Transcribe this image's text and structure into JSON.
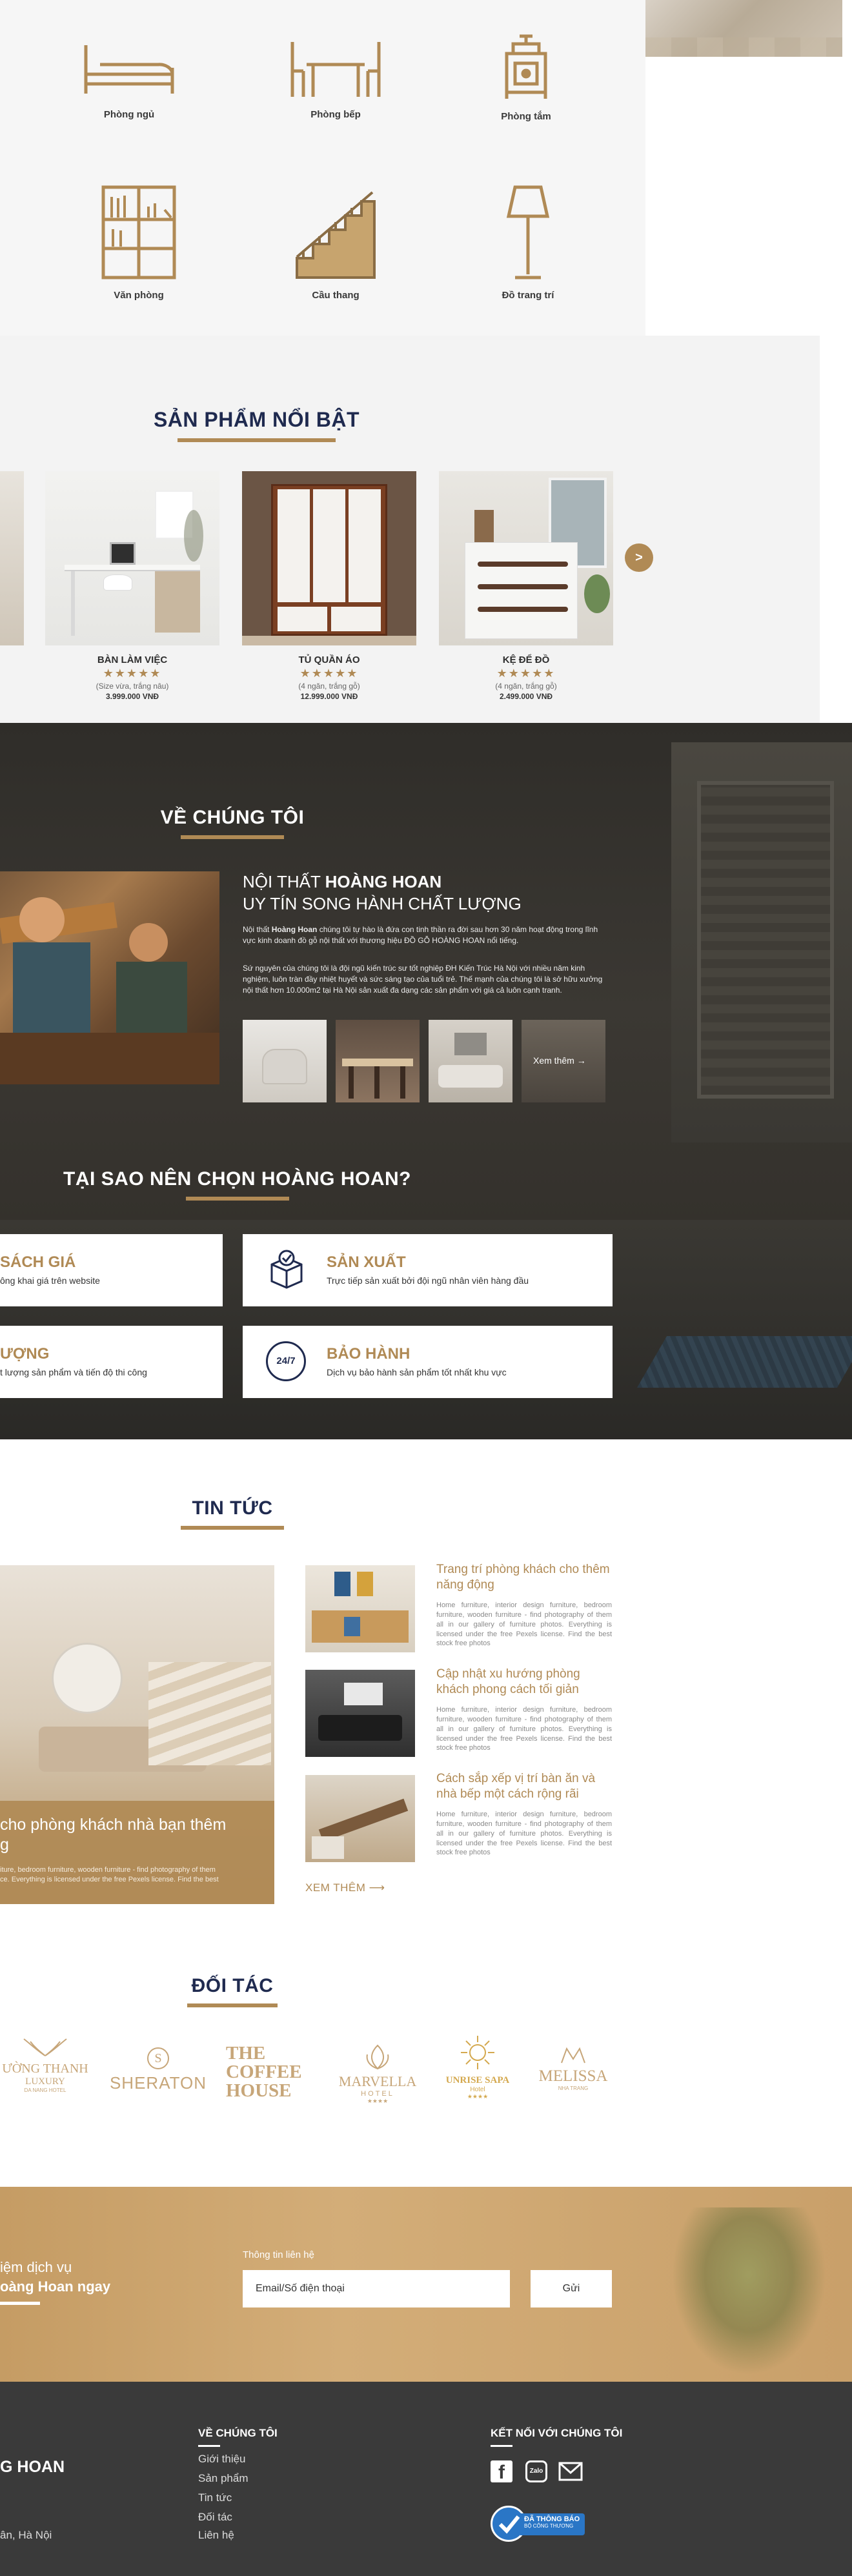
{
  "categories": {
    "items": [
      {
        "label": "Phòng ngủ",
        "icon": "bed-icon"
      },
      {
        "label": "Phòng bếp",
        "icon": "dining-table-icon"
      },
      {
        "label": "Phòng tắm",
        "icon": "coffee-grinder-icon"
      },
      {
        "label": "Văn phòng",
        "icon": "bookshelf-icon"
      },
      {
        "label": "Cầu thang",
        "icon": "staircase-icon"
      },
      {
        "label": "Đồ trang trí",
        "icon": "floor-lamp-icon"
      }
    ]
  },
  "featured": {
    "title": "SẢN PHẨM NỔI BẬT",
    "stars": "★★★★★",
    "next_label": ">",
    "products": [
      {
        "name": "BÀN LÀM VIỆC",
        "spec": "(Size vừa, trắng nâu)",
        "price": "3.999.000 VNĐ"
      },
      {
        "name": "TỦ QUẦN ÁO",
        "spec": "(4 ngăn, trắng gỗ)",
        "price": "12.999.000 VNĐ"
      },
      {
        "name": "KỆ ĐỂ ĐỒ",
        "spec": "(4 ngăn, trắng gỗ)",
        "price": "2.499.000 VNĐ"
      }
    ]
  },
  "about": {
    "title": "VỀ CHÚNG TÔI",
    "heading_prefix": "NỘI THẤT ",
    "heading_brand": "HOÀNG HOAN",
    "subheading": "UY TÍN SONG HÀNH CHẤT LƯỢNG",
    "para1_prefix": "Nội thất ",
    "para1_brand": "Hoàng Hoan",
    "para1_rest": " chúng tôi tự hào là đứa con tinh thần ra đời sau hơn 30 năm hoạt động trong lĩnh vực kinh doanh đồ gỗ nội thất với thương hiệu ĐỒ GỖ HOÀNG HOAN nổi tiếng.",
    "para2": "Sứ nguyên của chúng tôi là đội ngũ kiến trúc sư tốt nghiệp ĐH Kiến Trúc Hà Nội với nhiều năm kinh nghiệm, luôn tràn đầy nhiệt huyết và sức sáng tạo của tuổi trẻ. Thế mạnh của chúng tôi là sở hữu xưởng nội thất hơn 10.000m2 tại Hà Nội sản xuất đa dạng các sản phẩm với giá cả luôn cạnh tranh.",
    "more_label": "Xem thêm →"
  },
  "why": {
    "title": "TẠI SAO NÊN CHỌN HOÀNG HOAN?",
    "cards": [
      {
        "title": "SÁCH GIÁ",
        "desc": "ông khai giá trên website",
        "icon": ""
      },
      {
        "title": "SẢN XUẤT",
        "desc": "Trực tiếp sản xuất bởi đội ngũ nhân viên hàng đầu",
        "icon": "verified-box-icon"
      },
      {
        "title": "ƯỢNG",
        "desc": "t lượng sản phẩm và tiến độ thi công",
        "icon": ""
      },
      {
        "title": "BẢO HÀNH",
        "desc": "Dịch vụ bảo hành sản phẩm tốt nhất khu vực",
        "icon": "support-24-7-icon",
        "badge": "24/7"
      }
    ]
  },
  "news": {
    "title": "TIN TỨC",
    "feature_caption": " cho phòng khách nhà bạn thêm\ng",
    "feature_desc": "iture, bedroom furniture, wooden furniture - find photography of them\nce. Everything is licensed under the free Pexels license. Find the best",
    "items": [
      {
        "title": "Trang trí phòng khách cho thêm năng động",
        "desc": "Home furniture, interior design furniture, bedroom furniture, wooden furniture - find photography of them all in our gallery of furniture photos. Everything is licensed under the free Pexels license. Find the best stock free photos"
      },
      {
        "title": "Cập nhật xu hướng phòng khách phong cách tối giản",
        "desc": "Home furniture, interior design furniture, bedroom furniture, wooden furniture - find photography of them all in our gallery of furniture photos. Everything is licensed under the free Pexels license. Find the best stock free photos"
      },
      {
        "title": "Cách sắp xếp vị trí bàn ăn và nhà bếp một cách rộng rãi",
        "desc": "Home furniture, interior design furniture, bedroom furniture, wooden furniture - find photography of them all in our gallery of furniture photos. Everything is licensed under the free Pexels license. Find the best stock free photos"
      }
    ],
    "more_label": "XEM THÊM ⟶"
  },
  "partners": {
    "title": "ĐỐI TÁC",
    "logos": [
      {
        "main": "ƯỜNG THANH",
        "sub": "LUXURY",
        "tag": "DA NANG HOTEL"
      },
      {
        "main": "SHERATON",
        "sub": "S",
        "tag": ""
      },
      {
        "main": "THE COFFEE HOUSE",
        "sub": "",
        "tag": ""
      },
      {
        "main": "MARVELLA",
        "sub": "HOTEL",
        "tag": "★★★★"
      },
      {
        "main": "UNRISE SAPA",
        "sub": "Hotel",
        "tag": "★★★★"
      },
      {
        "main": "MELISSA",
        "sub": "",
        "tag": "NHA TRANG"
      }
    ]
  },
  "contact": {
    "left_line1": "iệm dịch vụ",
    "left_line2": "oàng Hoan ngay",
    "label": "Thông tin liên hệ",
    "placeholder": "Email/Số điện thoại",
    "submit": "Gửi"
  },
  "footer": {
    "brand": "G HOAN",
    "address": "ân, Hà Nội",
    "about_heading": "VỀ CHÚNG TÔI",
    "links": [
      "Giới thiệu",
      "Sản phẩm",
      "Tin tức",
      "Đối tác",
      "Liên hệ"
    ],
    "connect_heading": "KẾT NỐI VỚI CHÚNG TÔI",
    "zalo": "Zalo",
    "badge_line1": "ĐÃ THÔNG BÁO",
    "badge_line2": "BỘ CÔNG THƯƠNG"
  },
  "colors": {
    "accent": "#b08a55",
    "navy": "#1f2a4f",
    "dark": "#3a3a3a"
  }
}
